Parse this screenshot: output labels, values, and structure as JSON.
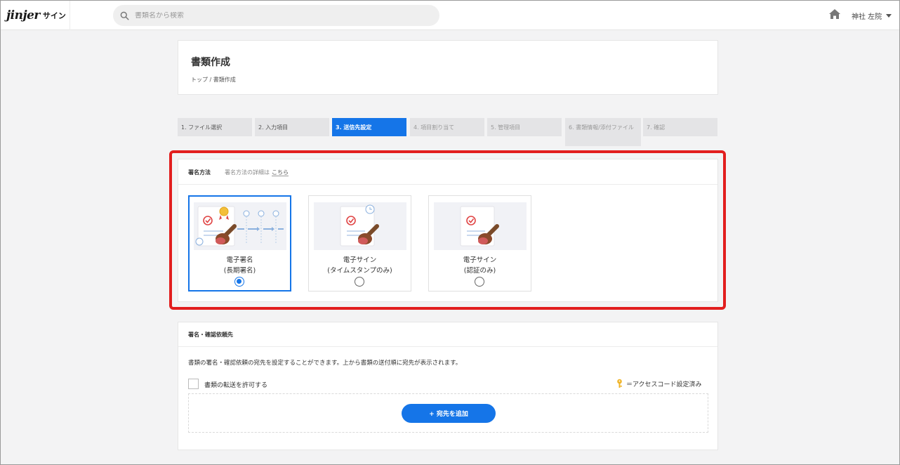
{
  "header": {
    "logo_mark": "jinjer",
    "logo_product": "サイン",
    "search_placeholder": "書類名から検索",
    "user_name": "神社 左院"
  },
  "page": {
    "title": "書類作成",
    "breadcrumb": "トップ / 書類作成"
  },
  "steps": [
    {
      "label": "1. ファイル選択",
      "state": "done"
    },
    {
      "label": "2. 入力項目",
      "state": "done"
    },
    {
      "label": "3. 送信先設定",
      "state": "active"
    },
    {
      "label": "4. 項目割り当て",
      "state": "future"
    },
    {
      "label": "5. 管理項目",
      "state": "future"
    },
    {
      "label": "6. 書類情報/添付ファイル",
      "state": "future"
    },
    {
      "label": "7. 確認",
      "state": "future"
    }
  ],
  "signature": {
    "title": "署名方法",
    "detail_prefix": "署名方法の詳細は",
    "detail_link": "こちら",
    "options": [
      {
        "line1": "電子署名",
        "line2": "(長期署名)",
        "selected": true
      },
      {
        "line1": "電子サイン",
        "line2": "(タイムスタンプのみ)",
        "selected": false
      },
      {
        "line1": "電子サイン",
        "line2": "(認証のみ)",
        "selected": false
      }
    ]
  },
  "recipients": {
    "title": "署名・確認依頼先",
    "description": "書類の署名・確認依頼の宛先を設定することができます。上から書類の送付順に宛先が表示されます。",
    "forward_label": "書類の転送を許可する",
    "key_legend": "＝アクセスコード設定済み",
    "add_button": "+ 宛先を追加"
  },
  "colors": {
    "accent": "#1575e8",
    "highlight": "#e21e1e"
  }
}
